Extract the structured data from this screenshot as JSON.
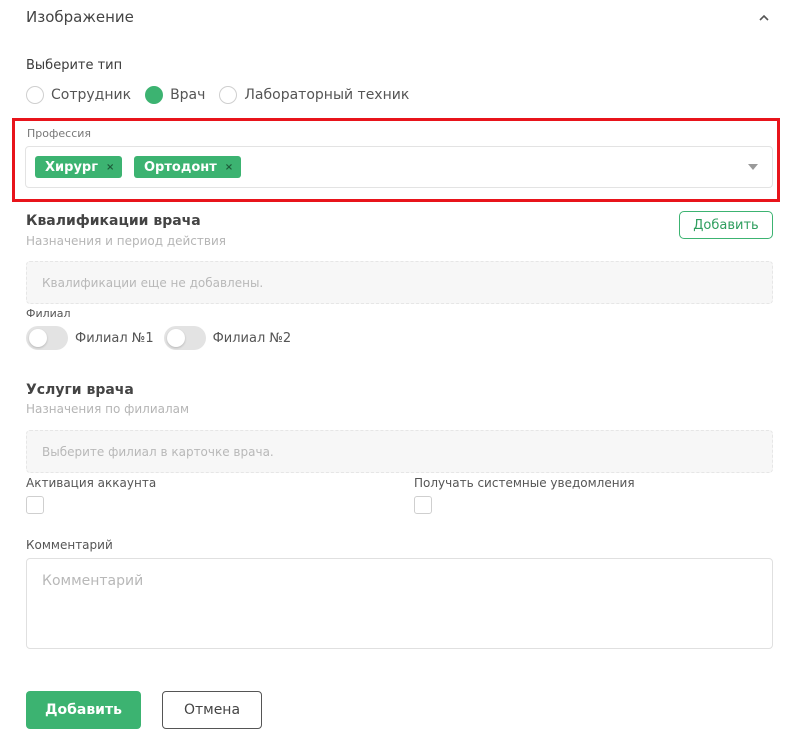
{
  "section": {
    "title": "Изображение",
    "collapse_icon": "chevron-up-icon"
  },
  "type_select": {
    "label": "Выберите тип",
    "options": [
      {
        "label": "Сотрудник",
        "checked": false
      },
      {
        "label": "Врач",
        "checked": true
      },
      {
        "label": "Лабораторный техник",
        "checked": false
      }
    ]
  },
  "profession": {
    "label": "Профессия",
    "selected": [
      "Хирург",
      "Ортодонт"
    ],
    "remove_glyph": "×",
    "dropdown_icon": "caret-down-icon"
  },
  "qualifications": {
    "title": "Квалификации врача",
    "subtitle": "Назначения и период действия",
    "add_label": "Добавить",
    "empty_text": "Квалификации еще не добавлены."
  },
  "branch": {
    "label": "Филиал",
    "toggles": [
      {
        "label": "Филиал №1",
        "on": false
      },
      {
        "label": "Филиал №2",
        "on": false
      }
    ]
  },
  "services": {
    "title": "Услуги врача",
    "subtitle": "Назначения по филиалам",
    "empty_text": "Выберите филиал в карточке врача."
  },
  "account": {
    "activation_label": "Активация аккаунта",
    "notifications_label": "Получать системные уведомления"
  },
  "comment": {
    "label": "Комментарий",
    "placeholder": "Комментарий"
  },
  "actions": {
    "submit_label": "Добавить",
    "cancel_label": "Отмена"
  },
  "colors": {
    "accent": "#3cb371",
    "highlight": "#e8141b"
  }
}
